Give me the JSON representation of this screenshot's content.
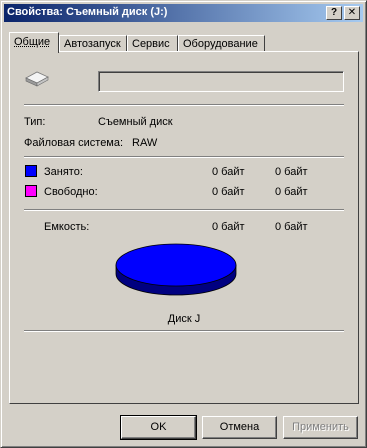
{
  "window": {
    "title": "Свойства: Съемный диск (J:)",
    "help_label": "?",
    "close_label": "✕"
  },
  "tabs": [
    {
      "label": "Общие",
      "active": true
    },
    {
      "label": "Автозапуск",
      "active": false
    },
    {
      "label": "Сервис",
      "active": false
    },
    {
      "label": "Оборудование",
      "active": false
    }
  ],
  "general": {
    "drive_icon": "removable-drive-icon",
    "volume_label_value": "",
    "type_label": "Тип:",
    "type_value": "Съемный диск",
    "fs_label": "Файловая система:",
    "fs_value": "RAW",
    "used_label": "Занято:",
    "used_bytes": "0 байт",
    "used_size": "0 байт",
    "used_color": "#0000ff",
    "free_label": "Свободно:",
    "free_bytes": "0 байт",
    "free_size": "0 байт",
    "free_color": "#ff00ff",
    "capacity_label": "Емкость:",
    "capacity_bytes": "0 байт",
    "capacity_size": "0 байт",
    "pie_color": "#0000ff",
    "disk_caption": "Диск J"
  },
  "buttons": {
    "ok": "OK",
    "cancel": "Отмена",
    "apply": "Применить"
  }
}
